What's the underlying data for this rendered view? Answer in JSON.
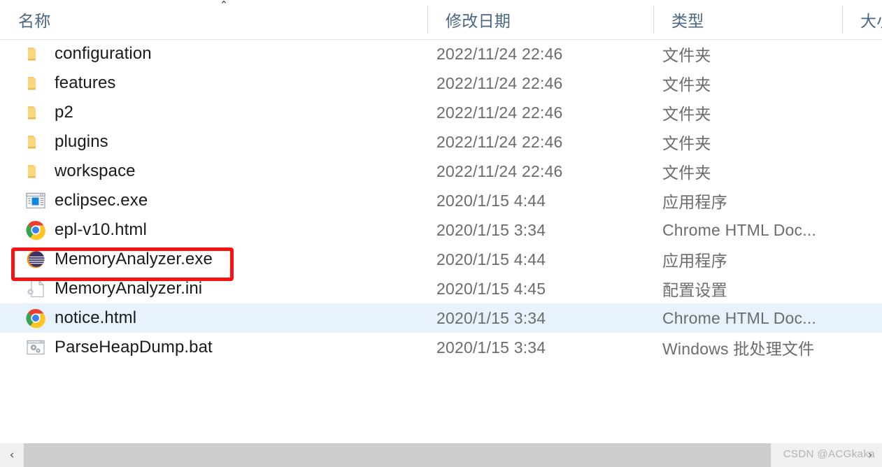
{
  "header": {
    "sort_indicator": "⌃",
    "columns": [
      {
        "key": "name",
        "label": "名称"
      },
      {
        "key": "date",
        "label": "修改日期"
      },
      {
        "key": "type",
        "label": "类型"
      },
      {
        "key": "size",
        "label": "大小"
      }
    ]
  },
  "rows": [
    {
      "icon": "folder-icon",
      "name": "configuration",
      "date": "2022/11/24 22:46",
      "type": "文件夹",
      "size": "",
      "selected": false,
      "highlighted": false
    },
    {
      "icon": "folder-icon",
      "name": "features",
      "date": "2022/11/24 22:46",
      "type": "文件夹",
      "size": "",
      "selected": false,
      "highlighted": false
    },
    {
      "icon": "folder-icon",
      "name": "p2",
      "date": "2022/11/24 22:46",
      "type": "文件夹",
      "size": "",
      "selected": false,
      "highlighted": false
    },
    {
      "icon": "folder-icon",
      "name": "plugins",
      "date": "2022/11/24 22:46",
      "type": "文件夹",
      "size": "",
      "selected": false,
      "highlighted": false
    },
    {
      "icon": "folder-icon",
      "name": "workspace",
      "date": "2022/11/24 22:46",
      "type": "文件夹",
      "size": "",
      "selected": false,
      "highlighted": false
    },
    {
      "icon": "application-icon",
      "name": "eclipsec.exe",
      "date": "2020/1/15 4:44",
      "type": "应用程序",
      "size": "",
      "selected": false,
      "highlighted": false
    },
    {
      "icon": "chrome-icon",
      "name": "epl-v10.html",
      "date": "2020/1/15 3:34",
      "type": "Chrome HTML Doc...",
      "size": "",
      "selected": false,
      "highlighted": false
    },
    {
      "icon": "memoryanalyzer-icon",
      "name": "MemoryAnalyzer.exe",
      "date": "2020/1/15 4:44",
      "type": "应用程序",
      "size": "",
      "selected": false,
      "highlighted": true
    },
    {
      "icon": "ini-file-icon",
      "name": "MemoryAnalyzer.ini",
      "date": "2020/1/15 4:45",
      "type": "配置设置",
      "size": "",
      "selected": false,
      "highlighted": false
    },
    {
      "icon": "chrome-icon",
      "name": "notice.html",
      "date": "2020/1/15 3:34",
      "type": "Chrome HTML Doc...",
      "size": "",
      "selected": true,
      "highlighted": false
    },
    {
      "icon": "batch-file-icon",
      "name": "ParseHeapDump.bat",
      "date": "2020/1/15 3:34",
      "type": "Windows 批处理文件",
      "size": "",
      "selected": false,
      "highlighted": false
    }
  ],
  "scrollbar": {
    "left_arrow": "‹",
    "right_arrow": "›"
  },
  "watermark": {
    "text": "CSDN @ACGkaka"
  },
  "colors": {
    "selection": "#e8f2fc",
    "highlight_box": "#fb1111",
    "header_text": "#4a6785",
    "folder": "#f9cb6a",
    "scroll_thumb": "#cdcdcd"
  }
}
